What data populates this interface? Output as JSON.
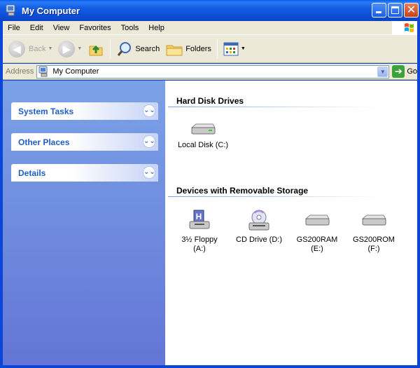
{
  "window": {
    "title": "My Computer"
  },
  "menu": [
    {
      "label": "File"
    },
    {
      "label": "Edit"
    },
    {
      "label": "View"
    },
    {
      "label": "Favorites"
    },
    {
      "label": "Tools"
    },
    {
      "label": "Help"
    }
  ],
  "toolbar": {
    "back_label": "Back",
    "search_label": "Search",
    "folders_label": "Folders"
  },
  "address": {
    "label": "Address",
    "value": "My Computer",
    "go_label": "Go"
  },
  "taskpane": {
    "groups": [
      {
        "label": "System Tasks"
      },
      {
        "label": "Other Places"
      },
      {
        "label": "Details"
      }
    ]
  },
  "content": {
    "hard_disk_heading": "Hard Disk Drives",
    "hard_disks": [
      {
        "label": "Local Disk (C:)"
      }
    ],
    "removable_heading": "Devices with Removable Storage",
    "removable": [
      {
        "label_line1": "3½ Floppy",
        "label_line2": "(A:)"
      },
      {
        "label_line1": "CD Drive (D:)",
        "label_line2": ""
      },
      {
        "label_line1": "GS200RAM",
        "label_line2": "(E:)"
      },
      {
        "label_line1": "GS200ROM",
        "label_line2": "(F:)"
      }
    ]
  },
  "colors": {
    "titlebar": "#0c4fd9",
    "taskpane_top": "#7ba2e7",
    "taskpane_bottom": "#6375d6",
    "group_label": "#215dc6"
  }
}
